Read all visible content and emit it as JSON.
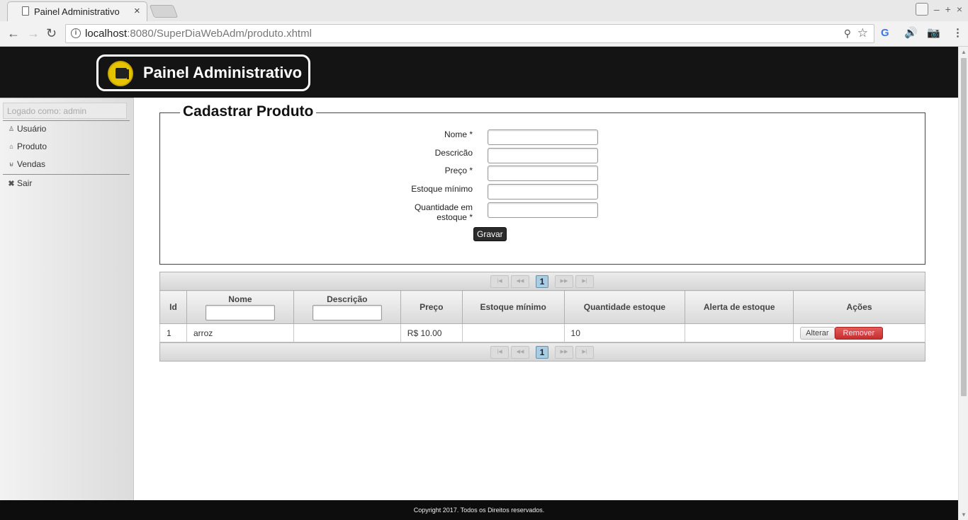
{
  "browser": {
    "tab_title": "Painel Administrativo",
    "tab_close": "×",
    "url_host": "localhost",
    "url_rest": ":8080/SuperDiaWebAdm/produto.xhtml",
    "win_minimize": "–",
    "win_maximize": "+",
    "win_close": "×"
  },
  "header": {
    "brand_title": "Painel Administrativo"
  },
  "sidebar": {
    "logged_as": "Logado como: admin",
    "items": [
      {
        "label": "Usuário",
        "icon": "user-icon"
      },
      {
        "label": "Produto",
        "icon": "home-icon"
      },
      {
        "label": "Vendas",
        "icon": "cart-icon"
      },
      {
        "label": "Sair",
        "icon": "close-icon"
      }
    ]
  },
  "form": {
    "legend": "Cadastrar Produto",
    "labels": {
      "nome": "Nome *",
      "descricao": "Descricão",
      "preco": "Preço *",
      "estoque_minimo": "Estoque mínimo",
      "quantidade_l1": "Quantidade em",
      "quantidade_l2": "estoque *"
    },
    "values": {
      "nome": "",
      "descricao": "",
      "preco": "",
      "estoque_minimo": "",
      "quantidade": ""
    },
    "submit_label": "Gravar"
  },
  "table": {
    "paginator": {
      "current_page": "1"
    },
    "columns": {
      "id": "Id",
      "nome": "Nome",
      "descricao": "Descrição",
      "preco": "Preço",
      "estoque_minimo": "Estoque mínimo",
      "quantidade": "Quantidade estoque",
      "alerta": "Alerta de estoque",
      "acoes": "Ações"
    },
    "rows": [
      {
        "id": "1",
        "nome": "arroz",
        "descricao": "",
        "preco": "R$ 10.00",
        "estoque_minimo": "",
        "quantidade": "10",
        "alerta": ""
      }
    ],
    "actions": {
      "alterar": "Alterar",
      "remover": "Remover"
    }
  },
  "footer": {
    "copyright": "Copyright 2017. Todos os Direitos reservados."
  }
}
